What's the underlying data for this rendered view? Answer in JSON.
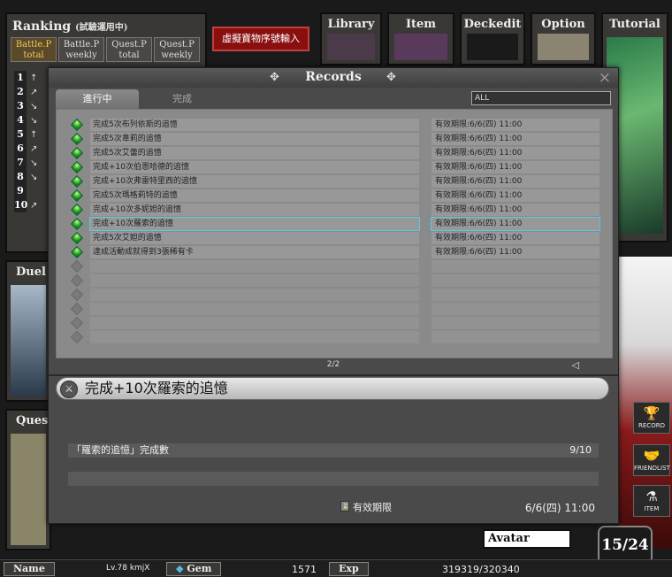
{
  "ranking": {
    "title": "Ranking",
    "subtitle": "(試驗運用中)",
    "tabs": [
      {
        "line1": "Battle.P",
        "line2": "total"
      },
      {
        "line1": "Battle.P",
        "line2": "weekly"
      },
      {
        "line1": "Quest.P",
        "line2": "total"
      },
      {
        "line1": "Quest.P",
        "line2": "weekly"
      }
    ],
    "ranks": [
      {
        "num": "1",
        "arrow": "↑"
      },
      {
        "num": "2",
        "arrow": "↗"
      },
      {
        "num": "3",
        "arrow": "↘"
      },
      {
        "num": "4",
        "arrow": "↘"
      },
      {
        "num": "5",
        "arrow": "↑"
      },
      {
        "num": "6",
        "arrow": "↗"
      },
      {
        "num": "7",
        "arrow": "↘"
      },
      {
        "num": "8",
        "arrow": "↘"
      },
      {
        "num": "9",
        "arrow": ""
      },
      {
        "num": "10",
        "arrow": "↗"
      }
    ]
  },
  "topbar": {
    "redeem_label": "虛擬寶物序號輸入",
    "library": "Library",
    "item": "Item",
    "deckedit": "Deckedit",
    "option": "Option",
    "tutorial": "Tutorial"
  },
  "side_panels": {
    "duel": "Duel",
    "quest": "Quest"
  },
  "side_icons": {
    "record": "RECORD",
    "friendlist": "FRIENDLIST",
    "item": "ITEM"
  },
  "modal": {
    "title": "Records",
    "close": "×",
    "tab_active": "進行中",
    "tab_inactive": "完成",
    "filter": "ALL",
    "rows": [
      {
        "name": "完成5次布列依斯的追憶",
        "date": "有效期限:6/6(四) 11:00"
      },
      {
        "name": "完成5次韋莉的追憶",
        "date": "有效期限:6/6(四) 11:00"
      },
      {
        "name": "完成5次艾蕾的追憶",
        "date": "有效期限:6/6(四) 11:00"
      },
      {
        "name": "完成+10次伯恩哈德的追憶",
        "date": "有效期限:6/6(四) 11:00"
      },
      {
        "name": "完成+10次弗雷特里西的追憶",
        "date": "有效期限:6/6(四) 11:00"
      },
      {
        "name": "完成5次瑪格莉特的追憶",
        "date": "有效期限:6/6(四) 11:00"
      },
      {
        "name": "完成+10次多妮妲的追憶",
        "date": "有效期限:6/6(四) 11:00"
      },
      {
        "name": "完成+10次羅索的追憶",
        "date": "有效期限:6/6(四) 11:00"
      },
      {
        "name": "完成5次艾妲的追憶",
        "date": "有效期限:6/6(四) 11:00"
      },
      {
        "name": "達成活動成就得到3張稀有卡",
        "date": "有效期限:6/6(四) 11:00"
      }
    ],
    "empty_rows": 6,
    "selected_index": 7,
    "pager": "2/2",
    "detail": {
      "title": "完成+10次羅索的追憶",
      "progress_label": "「羅索的追憶」完成數",
      "progress_value": "9/10",
      "expiry_label": "有效期限",
      "expiry_value": "6/6(四) 11:00"
    }
  },
  "status": {
    "name_label": "Name",
    "level_name": "Lv.78 kmjX",
    "gem_label": "Gem",
    "gem_value": "1571",
    "exp_label": "Exp",
    "exp_value": "319319/320340",
    "avatar_label": "Avatar",
    "level_badge": "15/24",
    "stars": "★★★"
  },
  "colors": {
    "accent_red": "#8a1010",
    "gem_green": "#1f9a1f",
    "select_highlight": "#5ac8e8"
  }
}
